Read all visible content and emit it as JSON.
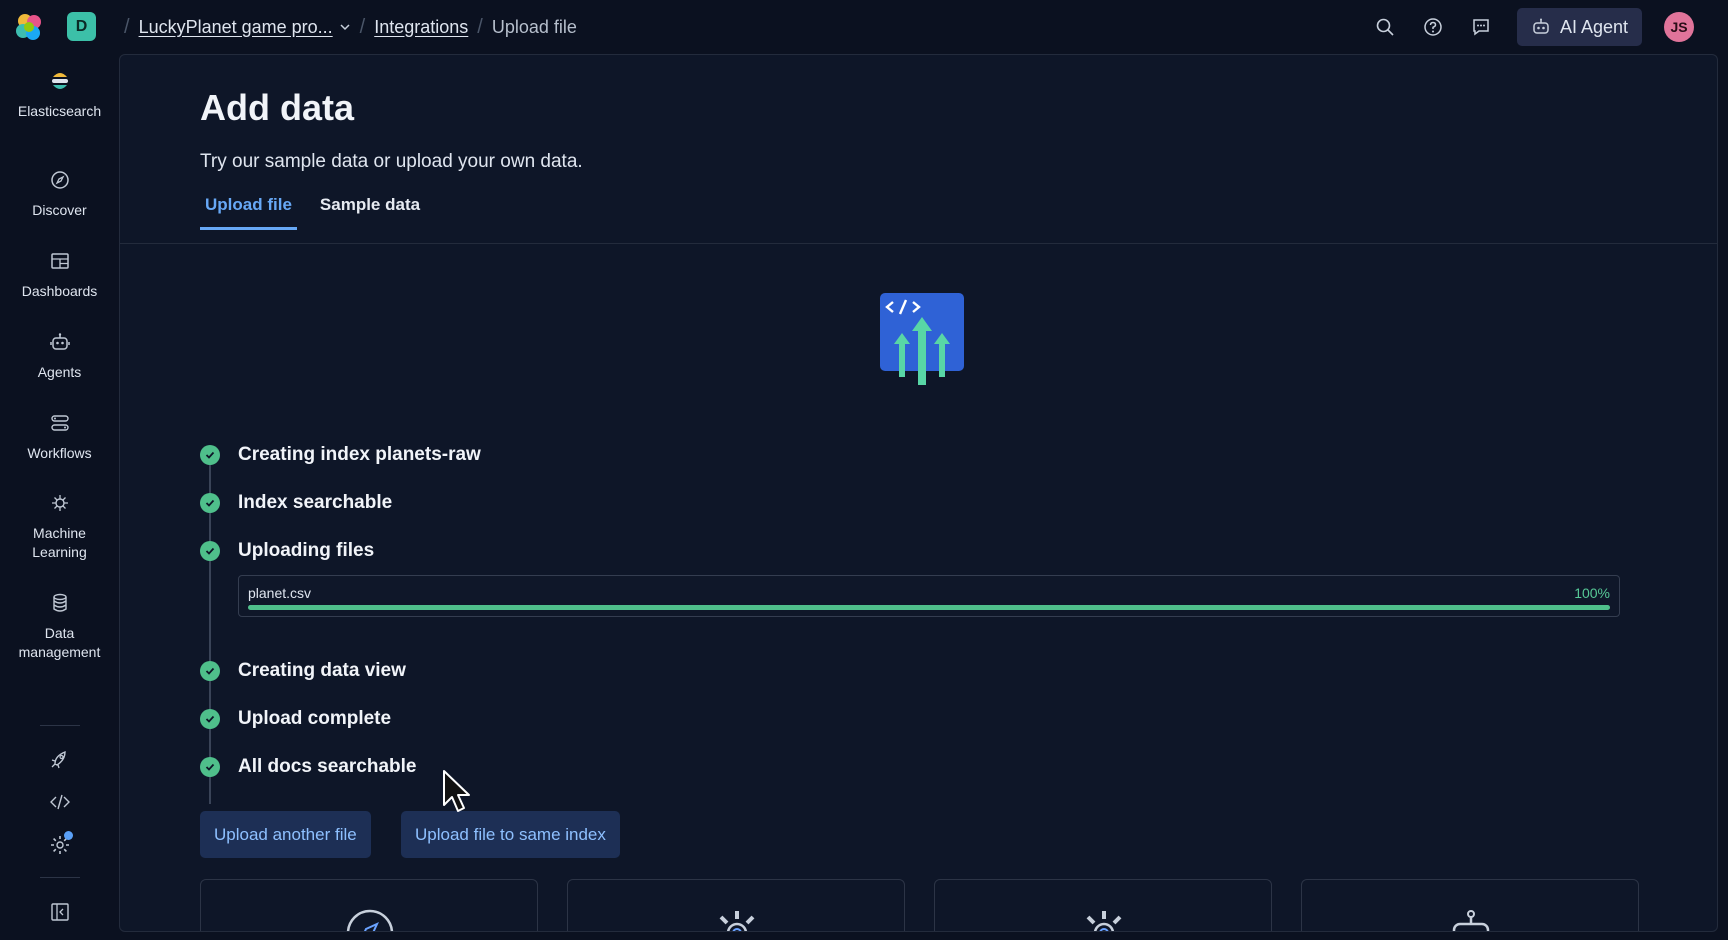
{
  "topbar": {
    "space_initial": "D",
    "breadcrumbs": [
      {
        "label": "LuckyPlanet game pro..."
      },
      {
        "label": "Integrations"
      },
      {
        "label": "Upload file"
      }
    ],
    "ai_agent_label": "AI Agent",
    "avatar_initials": "JS",
    "icons": [
      "search-icon",
      "help-icon",
      "feedback-icon"
    ]
  },
  "sidenav": {
    "items": [
      {
        "label": "Elasticsearch",
        "icon": "elasticsearch-logo-icon"
      },
      {
        "label": "Discover",
        "icon": "compass-icon"
      },
      {
        "label": "Dashboards",
        "icon": "dashboard-icon"
      },
      {
        "label": "Agents",
        "icon": "robot-icon"
      },
      {
        "label": "Workflows",
        "icon": "workflow-icon"
      },
      {
        "label": "Machine Learning",
        "icon": "machine-learning-icon"
      },
      {
        "label": "Data management",
        "icon": "database-icon"
      }
    ],
    "footer_icons": [
      "rocket-icon",
      "code-icon",
      "gear-icon",
      "collapse-panel-icon"
    ],
    "notification_color": "#5aa0f7"
  },
  "page": {
    "title": "Add data",
    "subtitle": "Try our sample data or upload your own data.",
    "tabs": [
      {
        "label": "Upload file",
        "active": true
      },
      {
        "label": "Sample data",
        "active": false
      }
    ]
  },
  "steps": [
    {
      "label": "Creating index planets-raw",
      "status": "complete"
    },
    {
      "label": "Index searchable",
      "status": "complete"
    },
    {
      "label": "Uploading files",
      "status": "complete"
    },
    {
      "label": "Creating data view",
      "status": "complete"
    },
    {
      "label": "Upload complete",
      "status": "complete"
    },
    {
      "label": "All docs searchable",
      "status": "complete"
    }
  ],
  "upload": {
    "file_name": "planet.csv",
    "progress_label": "100%",
    "progress": 1.0
  },
  "actions": {
    "upload_another": "Upload another file",
    "upload_same_index": "Upload file to same index"
  },
  "cards": [
    {
      "icon": "compass-icon"
    },
    {
      "icon": "gear-icon"
    },
    {
      "icon": "gear-icon"
    },
    {
      "icon": "robot-icon"
    }
  ],
  "colors": {
    "accent": "#67a8f6",
    "success": "#4fbf8b",
    "background": "#0b1120",
    "panel": "#0e1628",
    "button_bg": "#1d2f55"
  }
}
